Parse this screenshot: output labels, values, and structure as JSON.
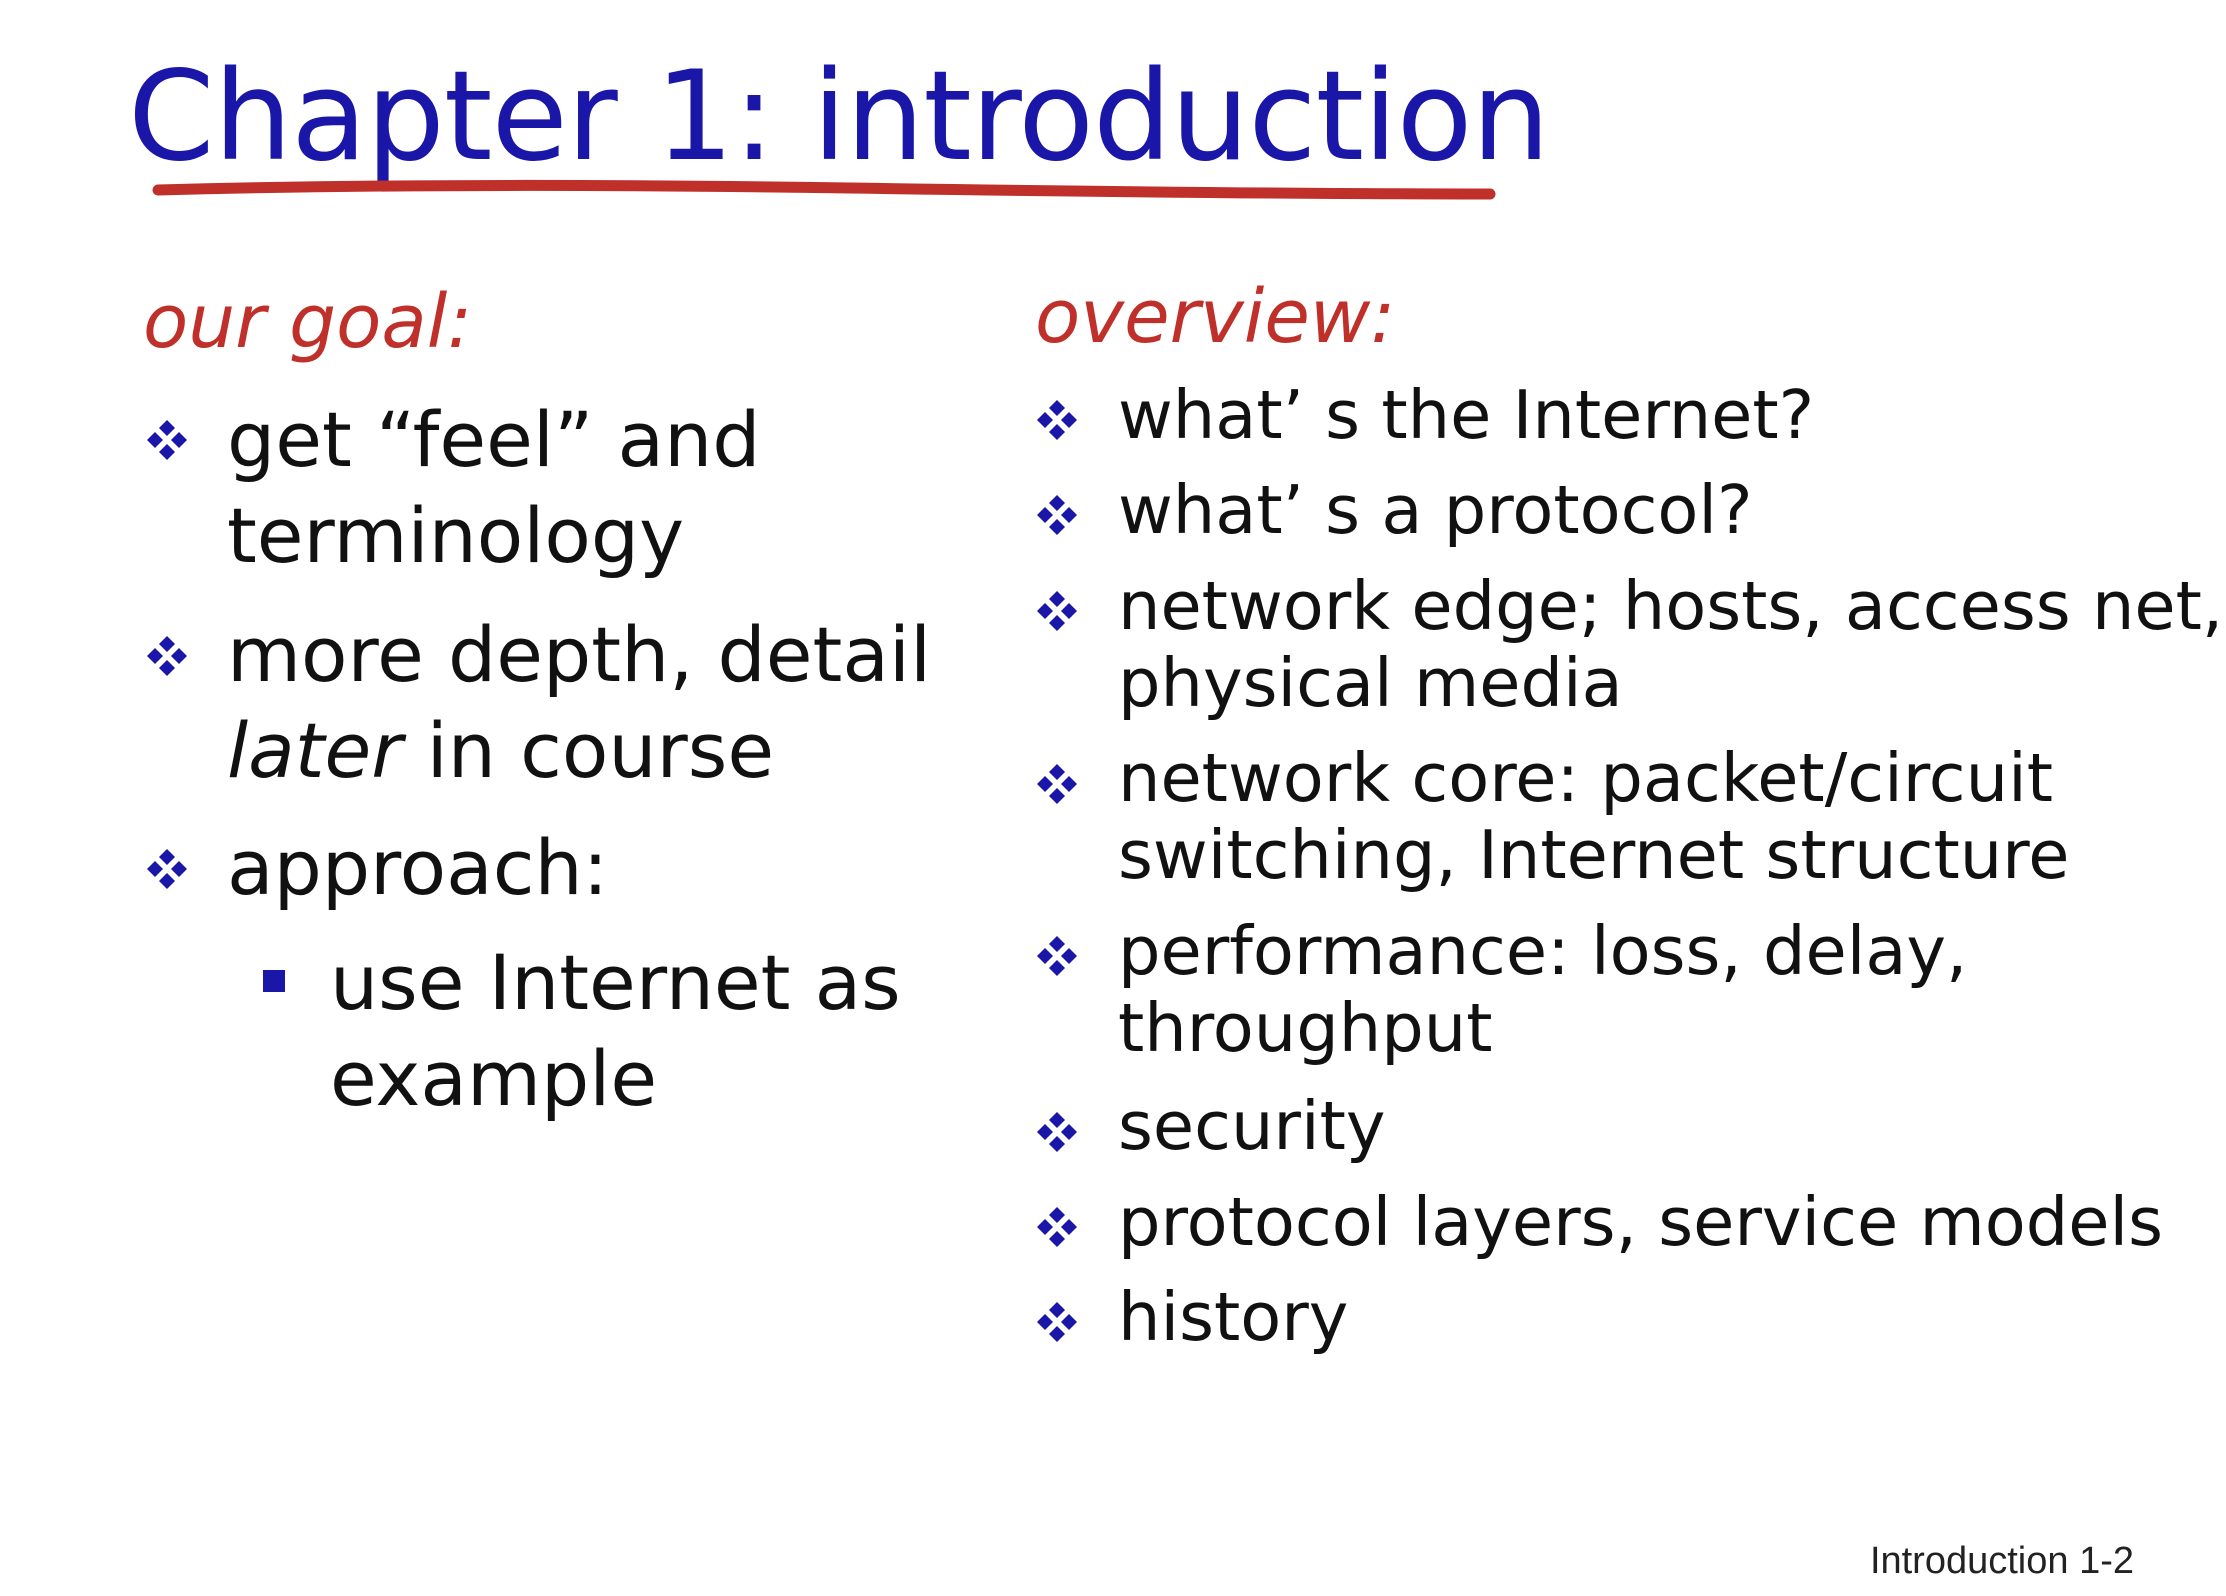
{
  "slide": {
    "title": "Chapter 1: introduction",
    "footer": "Introduction 1-2"
  },
  "colors": {
    "title": "#1a16a8",
    "heading": "#c0302a",
    "underline": "#c0302a",
    "bullet": "#1a16a8",
    "text": "#111111"
  },
  "goal": {
    "heading": "our goal:",
    "items": [
      {
        "line1": "get “feel” and",
        "line2": "terminology"
      },
      {
        "line1": "more depth, detail",
        "line2_italic": "later",
        "line2_rest": " in course"
      },
      {
        "line1": "approach:"
      }
    ],
    "subitems": [
      {
        "line1": "use Internet as",
        "line2": "example"
      }
    ]
  },
  "overview": {
    "heading": "overview:",
    "items": [
      {
        "line1": "what’ s the Internet?"
      },
      {
        "line1": "what’ s a protocol?"
      },
      {
        "line1": "network edge; hosts, access net,",
        "line2": "physical media"
      },
      {
        "line1": "network core: packet/circuit",
        "line2": "switching, Internet structure"
      },
      {
        "line1": "performance: loss, delay,",
        "line2": "throughput"
      },
      {
        "line1": "security"
      },
      {
        "line1": "protocol layers, service models"
      },
      {
        "line1": "history"
      }
    ]
  },
  "icons": {
    "main_bullet": "four-diamond-icon",
    "sub_bullet": "square-bullet-icon"
  }
}
